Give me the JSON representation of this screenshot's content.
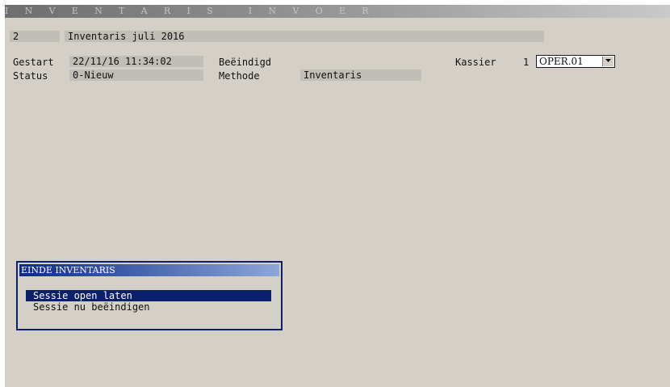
{
  "window": {
    "title": "I N V E N T A R I S   I N V O E R"
  },
  "header": {
    "number": "2",
    "description": "Inventaris juli 2016"
  },
  "fields": {
    "gestart_label": "Gestart",
    "gestart_value": "22/11/16 11:34:02",
    "beeindigd_label": "Beëindigd",
    "beeindigd_value": "",
    "kassier_label": "Kassier",
    "kassier_number": "1",
    "kassier_value": "OPER.01",
    "status_label": "Status",
    "status_value": "0-Nieuw",
    "methode_label": "Methode",
    "methode_value": "Inventaris"
  },
  "dialog": {
    "title": "EINDE INVENTARIS",
    "options": [
      "Sessie open laten",
      "Sessie nu beëindigen"
    ],
    "selected_index": 0
  },
  "colors": {
    "background": "#d4d0c8",
    "field": "#c1bdb7",
    "selection": "#0c1f6b"
  },
  "icons": {
    "dropdown": "chevron-down-icon"
  }
}
